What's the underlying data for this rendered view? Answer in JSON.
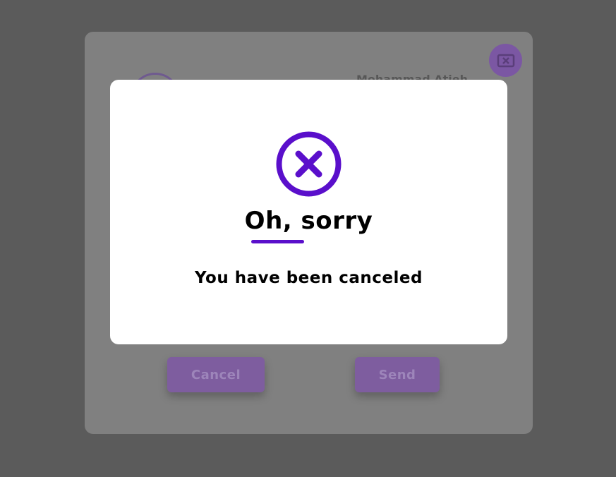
{
  "background_panel": {
    "name_text": "Mohammad Atieh",
    "cancel_label": "Cancel",
    "send_label": "Send"
  },
  "modal": {
    "icon": "cancel-circle-icon",
    "title": "Oh, sorry",
    "message": "You have been canceled"
  },
  "colors": {
    "accent": "#5a0fcb",
    "overlay": "#5b5b5b",
    "modal_bg": "#ffffff"
  }
}
